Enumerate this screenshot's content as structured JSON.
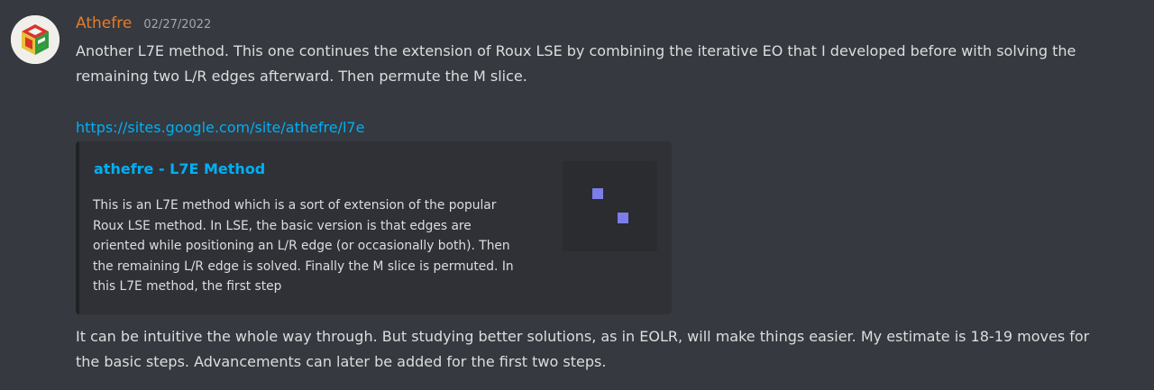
{
  "message": {
    "username": "Athefre",
    "timestamp": "02/27/2022",
    "line1": "Another L7E method. This one continues the extension of Roux LSE by combining the iterative EO that I developed before with solving the",
    "line2": "remaining two L/R edges afterward. Then permute the M slice.",
    "link": "https://sites.google.com/site/athefre/l7e",
    "line4": "It can be intuitive the whole way through. But studying better solutions, as in EOLR, will make things easier. My estimate is 18-19 moves for",
    "line5": "the basic steps. Advancements can later be added for the first two steps."
  },
  "embed": {
    "title": "athefre - L7E Method",
    "description_lines": [
      "This is an L7E method which is a sort of extension of the popular",
      "Roux LSE method. In LSE, the basic version is that edges are",
      "oriented while positioning an L/R edge (or occasionally both). Then",
      "the remaining L/R edge is solved. Finally the M slice is permuted. In",
      "this L7E method, the first step"
    ],
    "accent_color": "#202225",
    "thumbnail_color": "#7b7ee8"
  },
  "colors": {
    "background": "#36393f",
    "username": "#e47d29",
    "link": "#00aff4",
    "text": "#dcddde",
    "embed_bg": "#2f3136"
  },
  "icons": {
    "avatar": "cube-logo-icon",
    "thumbnail": "site-thumbnail-icon"
  }
}
